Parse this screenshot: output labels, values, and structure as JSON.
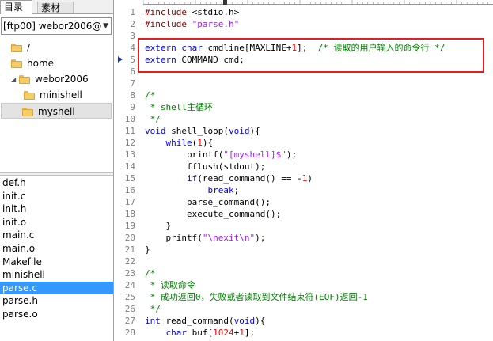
{
  "sidebar": {
    "tabs": [
      {
        "label": "目录"
      },
      {
        "label": "素材"
      }
    ],
    "server_combo": {
      "value": "[ftp00] webor2006@"
    },
    "tree": [
      {
        "label": "/"
      },
      {
        "label": "home"
      },
      {
        "label": "webor2006"
      },
      {
        "label": "minishell"
      },
      {
        "label": "myshell"
      }
    ],
    "files": [
      {
        "label": "def.h"
      },
      {
        "label": "init.c"
      },
      {
        "label": "init.h"
      },
      {
        "label": "init.o"
      },
      {
        "label": "main.c"
      },
      {
        "label": "main.o"
      },
      {
        "label": "Makefile"
      },
      {
        "label": "minishell"
      },
      {
        "label": "parse.c"
      },
      {
        "label": "parse.h"
      },
      {
        "label": "parse.o"
      }
    ]
  },
  "editor": {
    "lines": [
      {
        "n": "1",
        "segs": [
          [
            "pp",
            "#include "
          ],
          [
            "",
            "<stdio.h>"
          ]
        ]
      },
      {
        "n": "2",
        "segs": [
          [
            "pp",
            "#include "
          ],
          [
            "str",
            "\"parse.h\""
          ]
        ]
      },
      {
        "n": "3",
        "segs": []
      },
      {
        "n": "4",
        "segs": [
          [
            "kw",
            "extern "
          ],
          [
            "kw",
            "char "
          ],
          [
            "",
            "cmdline[MAXLINE+"
          ],
          [
            "num",
            "1"
          ],
          [
            "",
            "];  "
          ],
          [
            "cm",
            "/* 读取的用户输入的命令行 */"
          ]
        ]
      },
      {
        "n": "5",
        "segs": [
          [
            "kw",
            "extern "
          ],
          [
            "",
            "COMMAND cmd;"
          ]
        ]
      },
      {
        "n": "6",
        "segs": []
      },
      {
        "n": "7",
        "segs": []
      },
      {
        "n": "8",
        "segs": [
          [
            "cm",
            "/*"
          ]
        ]
      },
      {
        "n": "9",
        "segs": [
          [
            "cm",
            " * shell主循环"
          ]
        ]
      },
      {
        "n": "10",
        "segs": [
          [
            "cm",
            " */"
          ]
        ]
      },
      {
        "n": "11",
        "segs": [
          [
            "kw",
            "void "
          ],
          [
            "",
            "shell_loop("
          ],
          [
            "kw",
            "void"
          ],
          [
            "",
            ")"
          ],
          [
            "",
            "{"
          ]
        ]
      },
      {
        "n": "12",
        "segs": [
          [
            "",
            "    "
          ],
          [
            "kw",
            "while"
          ],
          [
            "",
            "("
          ],
          [
            "num",
            "1"
          ],
          [
            "",
            "){"
          ]
        ]
      },
      {
        "n": "13",
        "segs": [
          [
            "",
            "        printf("
          ],
          [
            "str",
            "\"[myshell]$\""
          ],
          [
            "",
            ");"
          ]
        ]
      },
      {
        "n": "14",
        "segs": [
          [
            "",
            "        fflush(stdout);"
          ]
        ]
      },
      {
        "n": "15",
        "segs": [
          [
            "",
            "        "
          ],
          [
            "kw",
            "if"
          ],
          [
            "",
            "(read_command() == -"
          ],
          [
            "num",
            "1"
          ],
          [
            "",
            ")"
          ]
        ]
      },
      {
        "n": "16",
        "segs": [
          [
            "",
            "            "
          ],
          [
            "kw",
            "break"
          ],
          [
            "",
            ";"
          ]
        ]
      },
      {
        "n": "17",
        "segs": [
          [
            "",
            "        parse_command();"
          ]
        ]
      },
      {
        "n": "18",
        "segs": [
          [
            "",
            "        execute_command();"
          ]
        ]
      },
      {
        "n": "19",
        "segs": [
          [
            "",
            "    }"
          ]
        ]
      },
      {
        "n": "20",
        "segs": [
          [
            "",
            "    printf("
          ],
          [
            "str",
            "\"\\nexit\\n\""
          ],
          [
            "",
            ");"
          ]
        ]
      },
      {
        "n": "21",
        "segs": [
          [
            "",
            "}"
          ]
        ]
      },
      {
        "n": "22",
        "segs": []
      },
      {
        "n": "23",
        "segs": [
          [
            "cm",
            "/*"
          ]
        ]
      },
      {
        "n": "24",
        "segs": [
          [
            "cm",
            " * 读取命令"
          ]
        ]
      },
      {
        "n": "25",
        "segs": [
          [
            "cm",
            " * 成功返回0，失败或者读取到文件结束符(EOF)返回-1"
          ]
        ]
      },
      {
        "n": "26",
        "segs": [
          [
            "cm",
            " */"
          ]
        ]
      },
      {
        "n": "27",
        "segs": [
          [
            "kw",
            "int "
          ],
          [
            "",
            "read_command("
          ],
          [
            "kw",
            "void"
          ],
          [
            "",
            "){"
          ]
        ]
      },
      {
        "n": "28",
        "segs": [
          [
            "",
            "    "
          ],
          [
            "kw",
            "char "
          ],
          [
            "",
            "buf["
          ],
          [
            "num",
            "1024"
          ],
          [
            "",
            "+"
          ],
          [
            "num",
            "1"
          ],
          [
            "",
            "];"
          ]
        ]
      }
    ]
  }
}
